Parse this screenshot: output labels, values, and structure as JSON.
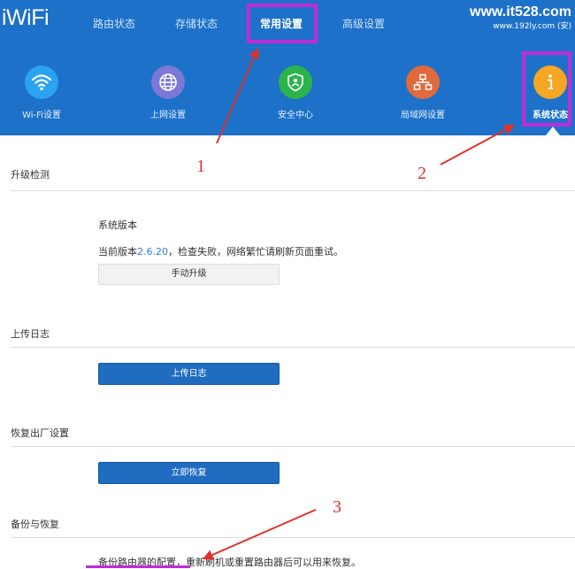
{
  "header": {
    "logo": "iWiFi",
    "tabs": [
      {
        "label": "路由状态",
        "active": false
      },
      {
        "label": "存储状态",
        "active": false
      },
      {
        "label": "常用设置",
        "active": true
      },
      {
        "label": "高级设置",
        "active": false
      }
    ],
    "watermark_main": "www.it528.com",
    "watermark_sub": "www.192ly.com (安)"
  },
  "icon_nav": [
    {
      "label": "Wi-Fi设置",
      "icon": "wifi-icon",
      "color": "#2aa3f0"
    },
    {
      "label": "上网设置",
      "icon": "globe-icon",
      "color": "#7a79d6"
    },
    {
      "label": "安全中心",
      "icon": "shield-icon",
      "color": "#2bb44a"
    },
    {
      "label": "局域网设置",
      "icon": "network-icon",
      "color": "#e06a3c"
    },
    {
      "label": "系统状态",
      "icon": "info-icon",
      "color": "#f5a623",
      "active": true
    }
  ],
  "sections": {
    "upgrade": {
      "title": "升级检测",
      "subtitle": "系统版本",
      "status_prefix": "当前版本",
      "version": "2.6.20",
      "status_suffix": "，检查失败，网络繁忙请刷新页面重试。",
      "button": "手动升级"
    },
    "log": {
      "title": "上传日志",
      "button": "上传日志"
    },
    "reset": {
      "title": "恢复出厂设置",
      "button": "立即恢复"
    },
    "backup": {
      "title": "备份与恢复",
      "description": "备份路由器的配置，重新刷机或重置路由器后可以用来恢复。"
    }
  },
  "annotations": {
    "marker1": "1",
    "marker2": "2",
    "marker3": "3",
    "highlight_color": "#c02bd8",
    "arrow_color": "#e0322b"
  }
}
